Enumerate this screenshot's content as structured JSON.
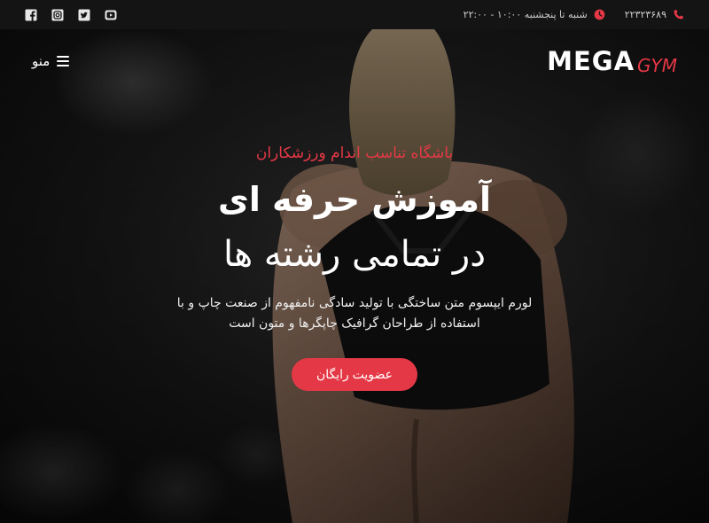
{
  "topbar": {
    "phone": "۲۲۳۲۳۶۸۹",
    "hours": "شنبه تا پنجشنبه ۱۰:۰۰ - ۲۲:۰۰",
    "accent_color": "#e53846",
    "social_icons": [
      "facebook-icon",
      "instagram-icon",
      "twitter-icon",
      "youtube-icon"
    ]
  },
  "navbar": {
    "logo_main": "MEGA",
    "logo_sub": "GYM",
    "menu_label": "منو"
  },
  "hero": {
    "eyebrow": "باشگاه تناسب اندام ورزشکاران",
    "headline_line1": "آموزش حرفه ای",
    "headline_line2": "در تمامی رشته ها",
    "description": "لورم ایپسوم متن ساختگی با تولید سادگی نامفهوم از صنعت چاپ و با استفاده از طراحان گرافیک چاپگرها و متون است",
    "cta_label": "عضویت رایگان"
  }
}
